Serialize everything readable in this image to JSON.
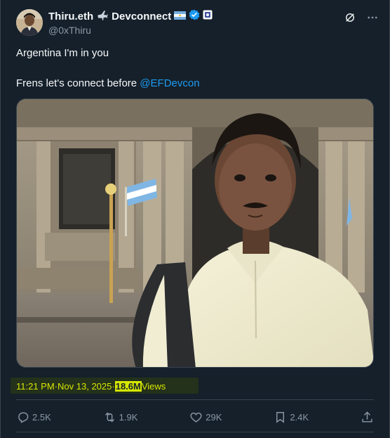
{
  "author": {
    "display_name": "Thiru.eth",
    "name_suffix": "Devconnect",
    "handle": "@0xThiru"
  },
  "tweet": {
    "line1": "Argentina I'm in you",
    "line2_prefix": "Frens let's connect before ",
    "mention": "@EFDevcon"
  },
  "meta": {
    "time": "11:21 PM",
    "separator": " · ",
    "date": "Nov 13, 2025",
    "separator2": " · ",
    "views_count": "18.6M",
    "views_label": " Views"
  },
  "actions": {
    "replies": "2.5K",
    "reposts": "1.9K",
    "likes": "29K",
    "bookmarks": "2.4K"
  },
  "colors": {
    "background": "#15202b",
    "accent": "#1d9bf0",
    "muted": "#8b98a5",
    "highlight": "#d6e600"
  },
  "icons": [
    "airplane-icon",
    "argentina-flag-icon",
    "verified-badge-icon",
    "affiliate-badge-icon",
    "grok-icon",
    "more-icon",
    "reply-icon",
    "repost-icon",
    "like-icon",
    "bookmark-icon",
    "share-icon"
  ]
}
